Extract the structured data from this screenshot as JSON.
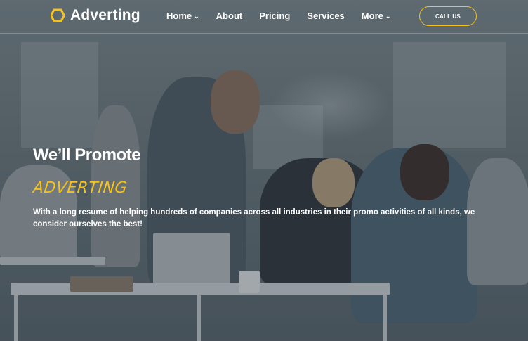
{
  "brand": {
    "name": "Adverting",
    "accent_color": "#f5c31a",
    "logo_icon": "hexagon-icon"
  },
  "nav": {
    "items": [
      {
        "label": "Home",
        "has_dropdown": true
      },
      {
        "label": "About",
        "has_dropdown": false
      },
      {
        "label": "Pricing",
        "has_dropdown": false
      },
      {
        "label": "Services",
        "has_dropdown": false
      },
      {
        "label": "More",
        "has_dropdown": true
      }
    ],
    "cta_label": "CALL US"
  },
  "hero": {
    "title": "We’ll Promote",
    "subtitle": "ADVERTING",
    "description": "With a long resume of helping hundreds of companies across all industries in their promo activities of all kinds, we consider ourselves the best!"
  }
}
